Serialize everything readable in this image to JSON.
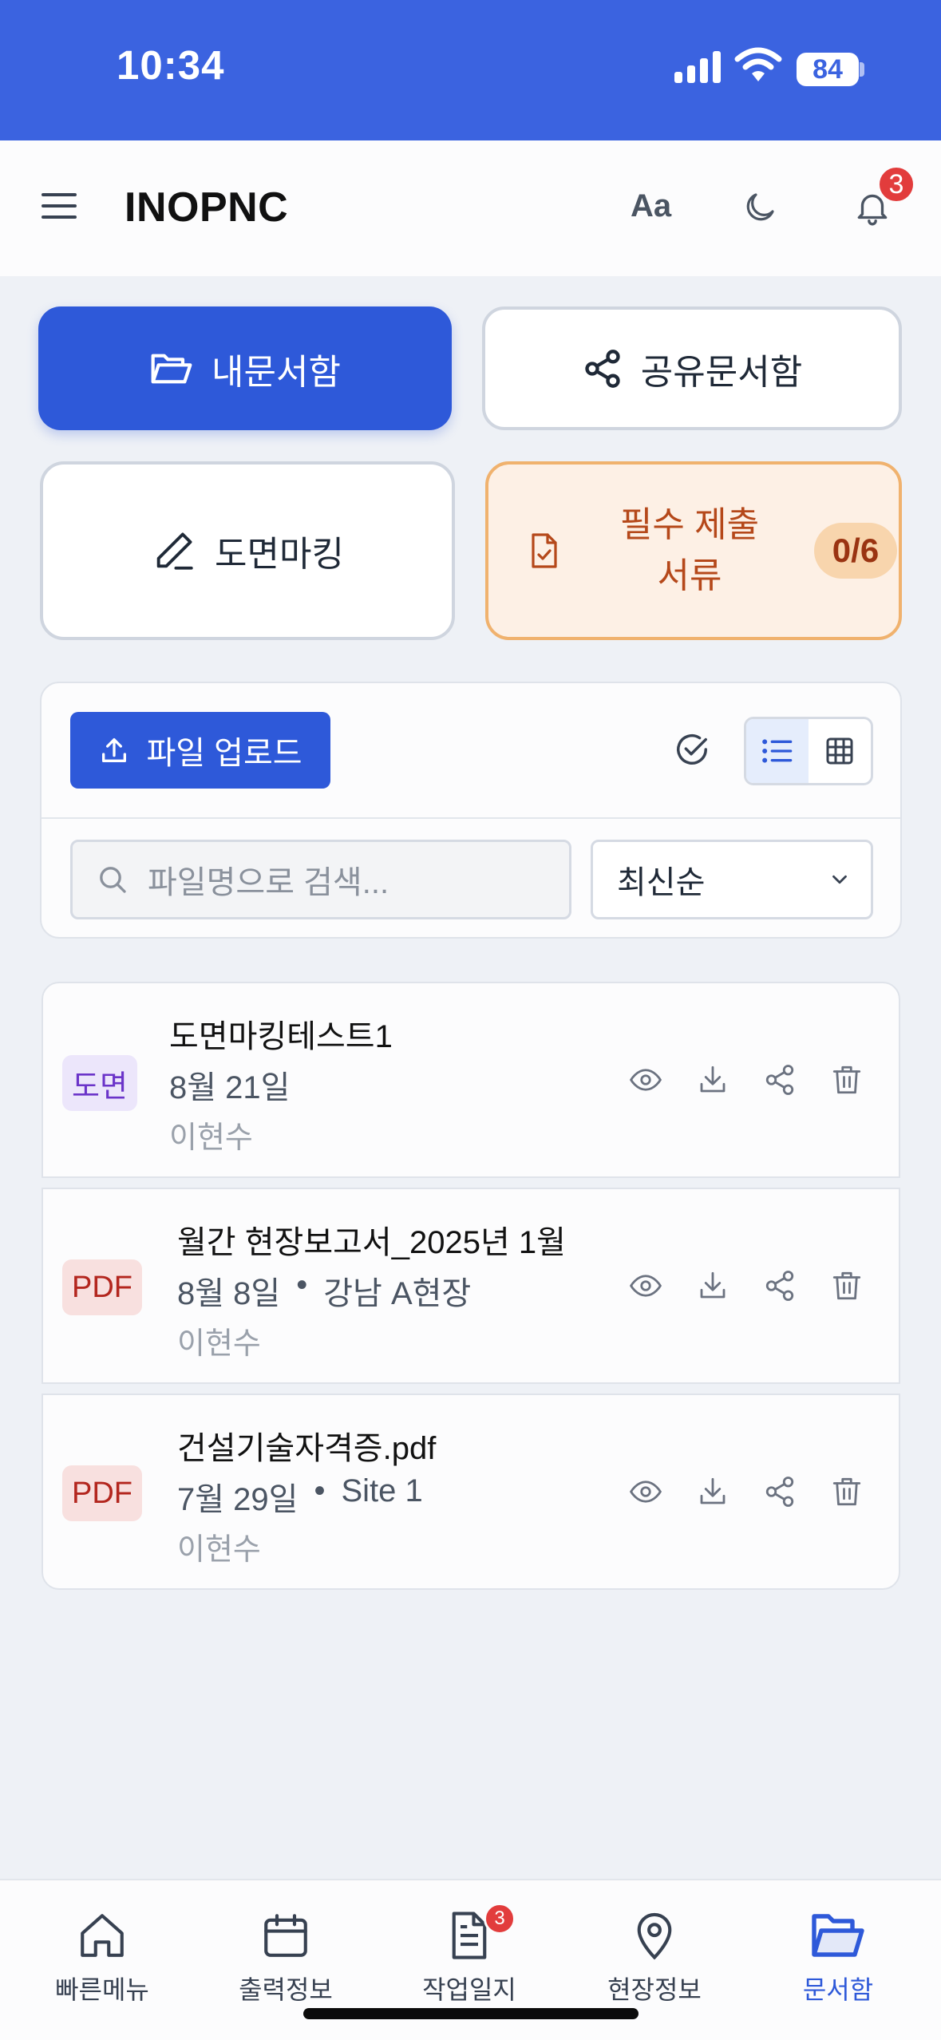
{
  "status_bar": {
    "time": "10:34",
    "battery": "84"
  },
  "header": {
    "title": "INOPNC",
    "font_toggle": "Aa",
    "notification_count": "3"
  },
  "actions": {
    "my_docs": "내문서함",
    "shared_docs": "공유문서함",
    "drawing_marking": "도면마킹",
    "required_docs_line1": "필수 제출",
    "required_docs_line2": "서류",
    "required_docs_count": "0/6"
  },
  "toolbar": {
    "upload_label": "파일 업로드",
    "search_placeholder": "파일명으로 검색...",
    "sort_selected": "최신순"
  },
  "files": [
    {
      "badge": "도면",
      "name": "도면마킹테스트1",
      "date": "8월 21일",
      "site": "",
      "owner": "이현수"
    },
    {
      "badge": "PDF",
      "name": "월간 현장보고서_2025년 1월",
      "date": "8월 8일",
      "site": "강남 A현장",
      "owner": "이현수"
    },
    {
      "badge": "PDF",
      "name": "건설기술자격증.pdf",
      "date": "7월 29일",
      "site": "Site 1",
      "owner": "이현수"
    }
  ],
  "meta_separator": "•",
  "bottom_nav": [
    {
      "label": "빠른메뉴"
    },
    {
      "label": "출력정보"
    },
    {
      "label": "작업일지",
      "badge": "3"
    },
    {
      "label": "현장정보"
    },
    {
      "label": "문서함"
    }
  ],
  "colors": {
    "primary": "#2e59d9",
    "status_bar": "#3b63e0",
    "warning_bg": "#fdf0e5",
    "warning_text": "#b5481a",
    "badge_red": "#e23c3c"
  }
}
